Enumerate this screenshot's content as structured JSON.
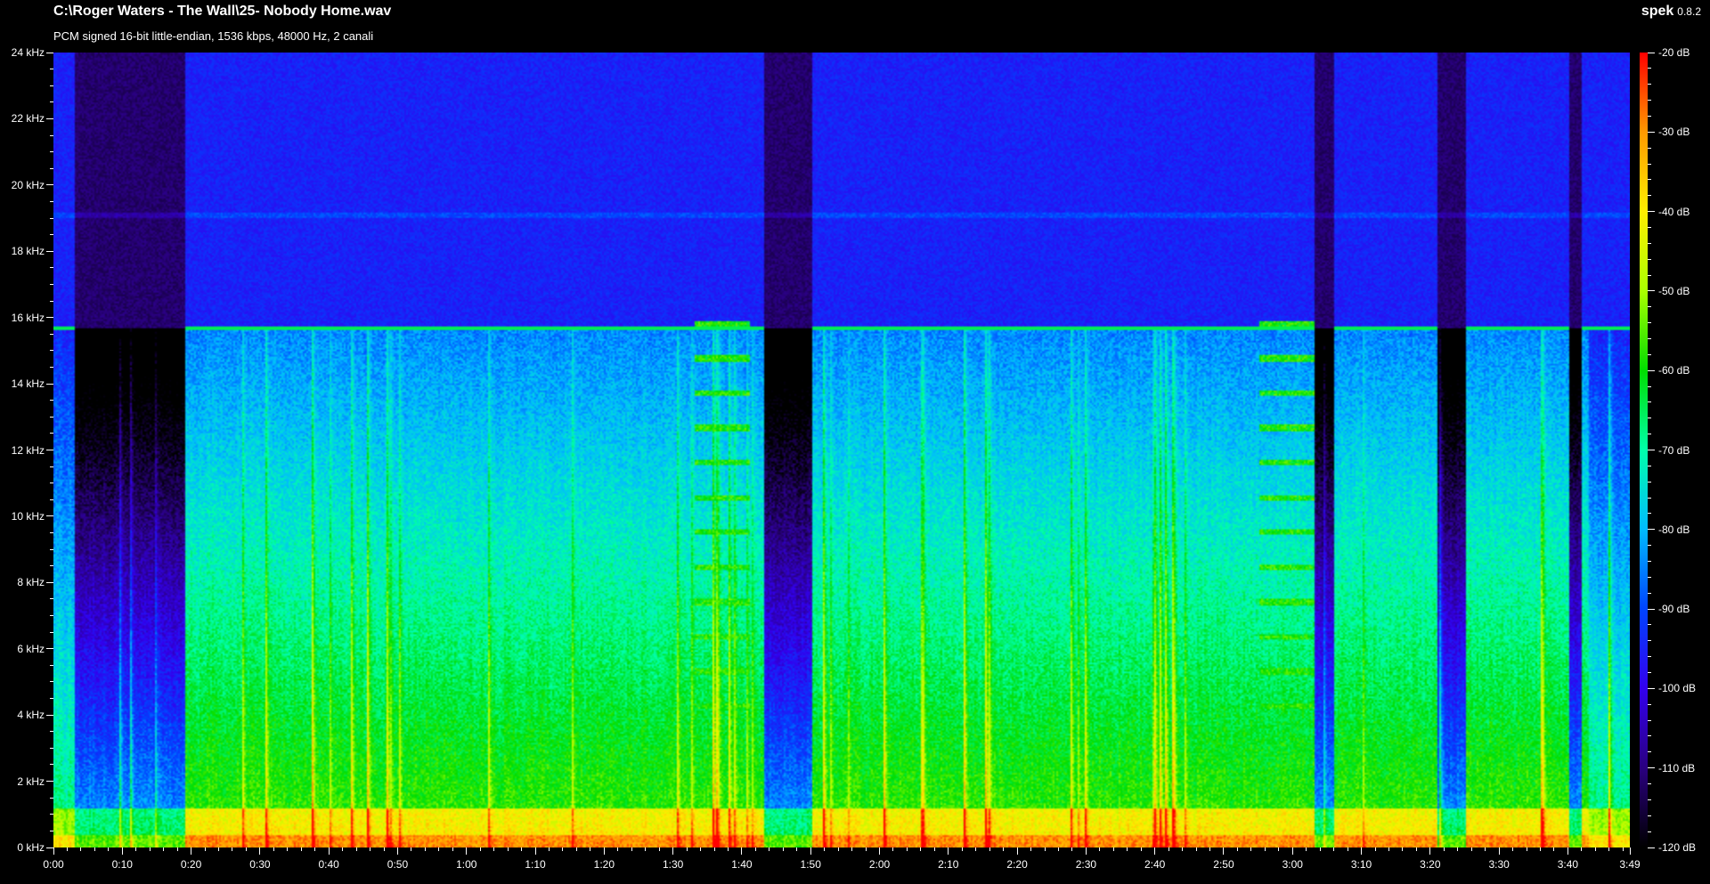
{
  "header": {
    "file_path": "C:\\Roger Waters - The Wall\\25- Nobody Home.wav",
    "file_info": "PCM signed 16-bit little-endian, 1536 kbps, 48000 Hz, 2 canali",
    "app_name": "spek",
    "app_version": "0.8.2"
  },
  "frequency_axis": {
    "labels": [
      "24 kHz",
      "22 kHz",
      "20 kHz",
      "18 kHz",
      "16 kHz",
      "14 kHz",
      "12 kHz",
      "10 kHz",
      "8 kHz",
      "6 kHz",
      "4 kHz",
      "2 kHz",
      "0 kHz"
    ],
    "max_khz": 24
  },
  "time_axis": {
    "labels": [
      "0:00",
      "0:10",
      "0:20",
      "0:30",
      "0:40",
      "0:50",
      "1:00",
      "1:10",
      "1:20",
      "1:30",
      "1:40",
      "1:50",
      "2:00",
      "2:10",
      "2:20",
      "2:30",
      "2:40",
      "2:50",
      "3:00",
      "3:10",
      "3:20",
      "3:30",
      "3:40",
      "3:49"
    ],
    "duration_seconds": 229
  },
  "db_scale": {
    "labels": [
      "-20 dB",
      "-30 dB",
      "-40 dB",
      "-50 dB",
      "-60 dB",
      "-70 dB",
      "-80 dB",
      "-90 dB",
      "-100 dB",
      "-110 dB",
      "-120 dB"
    ],
    "min_db": -120,
    "max_db": -20,
    "gradient_colors": [
      "#ff0000",
      "#ff9900",
      "#ffee00",
      "#aaff00",
      "#00dd00",
      "#00ffaa",
      "#00bbff",
      "#0044ff",
      "#3300ee",
      "#2a0080",
      "#000000"
    ]
  },
  "features": {
    "cutoff_khz": 15.7,
    "quiet_intervals_seconds": [
      [
        3,
        19
      ],
      [
        103,
        110
      ],
      [
        183,
        186
      ],
      [
        201,
        205
      ],
      [
        220,
        222
      ]
    ],
    "tone_train_intervals_seconds": [
      [
        93,
        101
      ],
      [
        175,
        183
      ]
    ]
  }
}
